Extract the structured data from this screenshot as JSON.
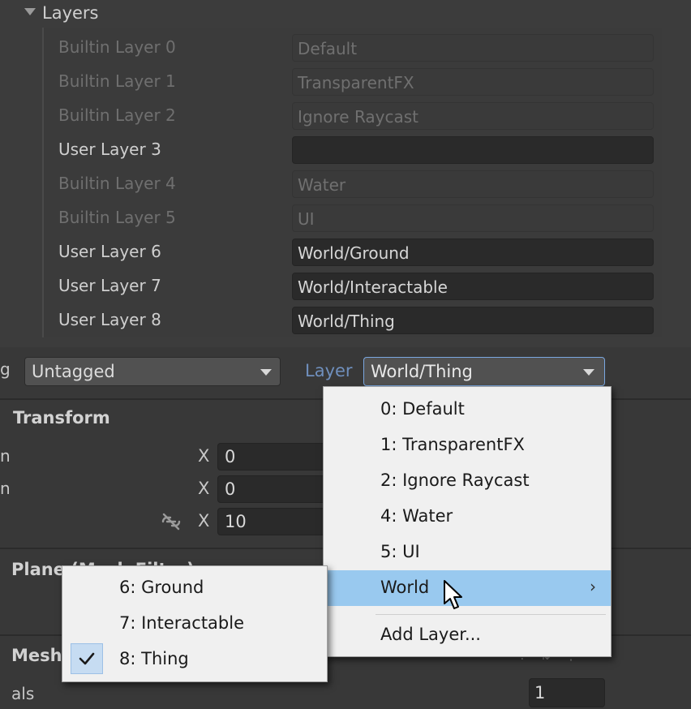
{
  "layers": {
    "title": "Layers",
    "rows": [
      {
        "label": "Builtin Layer 0",
        "value": "Default",
        "kind": "builtin"
      },
      {
        "label": "Builtin Layer 1",
        "value": "TransparentFX",
        "kind": "builtin"
      },
      {
        "label": "Builtin Layer 2",
        "value": "Ignore Raycast",
        "kind": "builtin"
      },
      {
        "label": "User Layer 3",
        "value": "",
        "kind": "user"
      },
      {
        "label": "Builtin Layer 4",
        "value": "Water",
        "kind": "builtin"
      },
      {
        "label": "Builtin Layer 5",
        "value": "UI",
        "kind": "builtin"
      },
      {
        "label": "User Layer 6",
        "value": "World/Ground",
        "kind": "user"
      },
      {
        "label": "User Layer 7",
        "value": "World/Interactable",
        "kind": "user"
      },
      {
        "label": "User Layer 8",
        "value": "World/Thing",
        "kind": "user"
      }
    ]
  },
  "inspector": {
    "tag_label_truncated": "g",
    "tag_value": "Untagged",
    "layer_label": "Layer",
    "layer_value": "World/Thing",
    "transform_title": "Transform",
    "transform_rows": [
      {
        "label_truncated": "n",
        "axis": "X",
        "value": "0"
      },
      {
        "label_truncated": "n",
        "axis": "X",
        "value": "0"
      },
      {
        "label_truncated": "",
        "axis": "X",
        "value": "10"
      }
    ],
    "plane_title": "Plane (Mesh Filter)",
    "mesh_title": "Mesh",
    "materials_label_truncated": "als",
    "materials_value": "1"
  },
  "layer_menu": {
    "items": [
      {
        "label": "0: Default"
      },
      {
        "label": "1: TransparentFX"
      },
      {
        "label": "2: Ignore Raycast"
      },
      {
        "label": "4: Water"
      },
      {
        "label": "5: UI"
      },
      {
        "label": "World",
        "highlighted": true,
        "submenu": true
      }
    ],
    "add_label": "Add Layer..."
  },
  "world_submenu": {
    "items": [
      {
        "label": "6: Ground",
        "checked": false
      },
      {
        "label": "7: Interactable",
        "checked": false
      },
      {
        "label": "8: Thing",
        "checked": true
      }
    ]
  },
  "colors": {
    "highlight": "#99c9ef",
    "layer_label": "#6f8fbd",
    "panel_bg": "#383838",
    "menu_bg": "#f0f0f0"
  }
}
